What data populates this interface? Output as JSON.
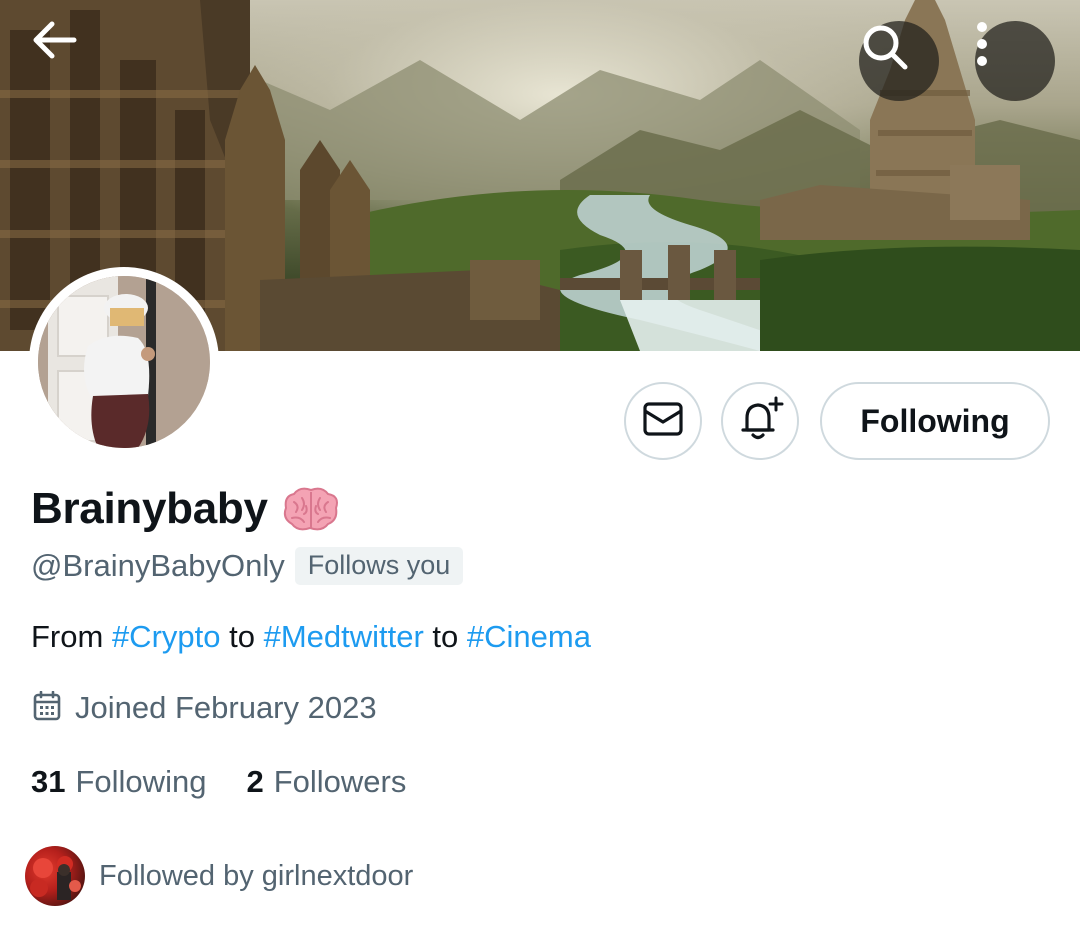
{
  "header": {
    "back_icon": "arrow-left-icon",
    "search_icon": "search-icon",
    "more_icon": "more-vertical-icon"
  },
  "profile": {
    "display_name": "Brainybaby",
    "name_emoji": "brain-icon",
    "handle": "@BrainyBabyOnly",
    "follows_you_badge": "Follows you",
    "bio": {
      "parts": [
        {
          "text": "From ",
          "hashtag": false
        },
        {
          "text": "#Crypto",
          "hashtag": true
        },
        {
          "text": " to ",
          "hashtag": false
        },
        {
          "text": "#Medtwitter",
          "hashtag": true
        },
        {
          "text": " to ",
          "hashtag": false
        },
        {
          "text": "#Cinema",
          "hashtag": true
        }
      ]
    },
    "joined": "Joined February 2023",
    "following_count": "31",
    "following_label": "Following",
    "followers_count": "2",
    "followers_label": "Followers",
    "followed_by": "Followed by girlnextdoor"
  },
  "actions": {
    "message_icon": "mail-icon",
    "notify_icon": "bell-plus-icon",
    "following_button": "Following"
  },
  "colors": {
    "accent": "#1d9bf0",
    "text_primary": "#0f1419",
    "text_secondary": "#536471",
    "border": "#cfd9de"
  }
}
